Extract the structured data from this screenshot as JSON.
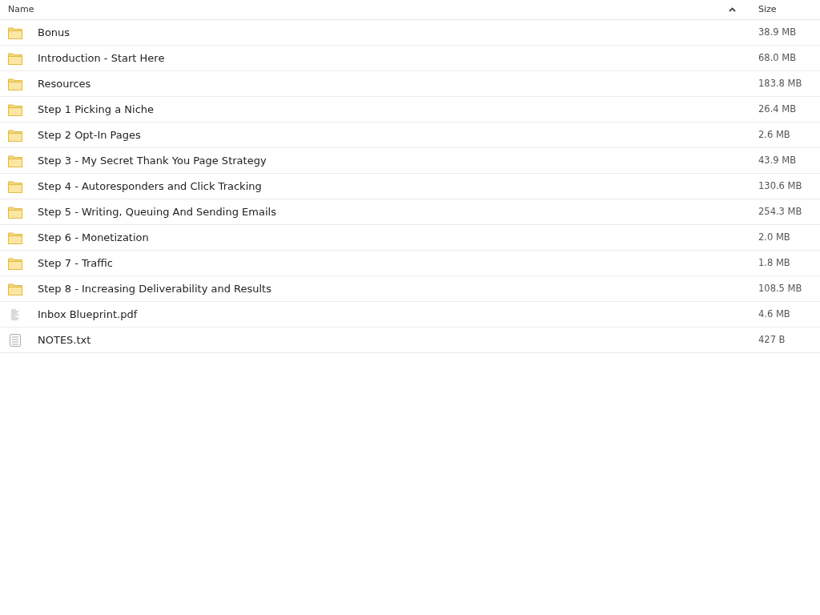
{
  "table": {
    "columns": [
      {
        "label": "Name",
        "sorted": true
      },
      {
        "label": "Size",
        "sorted": false
      }
    ],
    "rows": [
      {
        "kind": "folder",
        "name": "Bonus",
        "size": "38.9 MB"
      },
      {
        "kind": "folder",
        "name": "Introduction - Start Here",
        "size": "68.0 MB"
      },
      {
        "kind": "folder",
        "name": "Resources",
        "size": "183.8 MB"
      },
      {
        "kind": "folder",
        "name": "Step 1 Picking a Niche",
        "size": "26.4 MB"
      },
      {
        "kind": "folder",
        "name": "Step 2 Opt-In Pages",
        "size": "2.6 MB"
      },
      {
        "kind": "folder",
        "name": "Step 3 - My Secret Thank You Page Strategy",
        "size": "43.9 MB"
      },
      {
        "kind": "folder",
        "name": "Step 4 - Autoresponders and Click Tracking",
        "size": "130.6 MB"
      },
      {
        "kind": "folder",
        "name": "Step 5 - Writing, Queuing And Sending Emails",
        "size": "254.3 MB"
      },
      {
        "kind": "folder",
        "name": "Step 6 - Monetization",
        "size": "2.0 MB"
      },
      {
        "kind": "folder",
        "name": "Step 7 - Traffic",
        "size": "1.8 MB"
      },
      {
        "kind": "folder",
        "name": "Step 8 - Increasing Deliverability and Results",
        "size": "108.5 MB"
      },
      {
        "kind": "pdf",
        "name": "Inbox Blueprint.pdf",
        "size": "4.6 MB"
      },
      {
        "kind": "text",
        "name": "NOTES.txt",
        "size": "427 B"
      }
    ]
  }
}
